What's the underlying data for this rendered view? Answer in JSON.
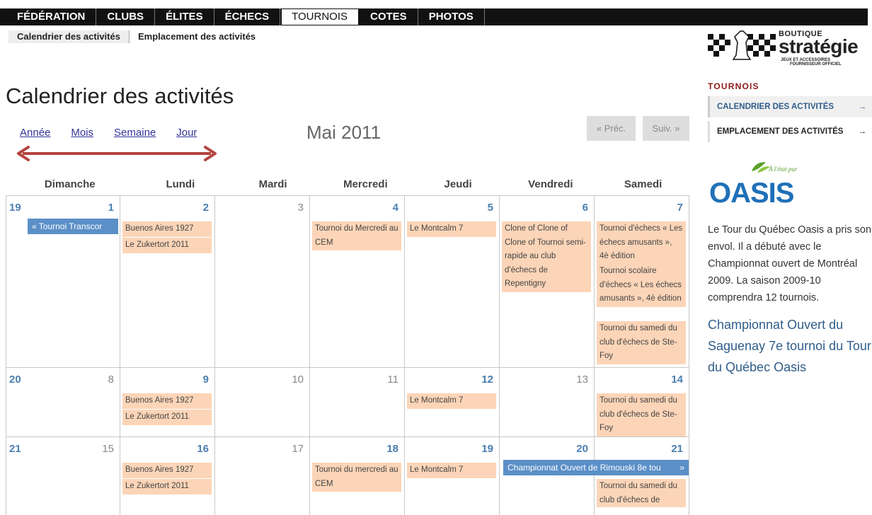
{
  "topnav": {
    "items": [
      {
        "label": "FÉDÉRATION"
      },
      {
        "label": "CLUBS"
      },
      {
        "label": "ÉLITES"
      },
      {
        "label": "ÉCHECS"
      },
      {
        "label": "TOURNOIS"
      },
      {
        "label": "COTES"
      },
      {
        "label": "PHOTOS"
      }
    ],
    "active": "TOURNOIS"
  },
  "subnav": {
    "items": [
      {
        "label": "Calendrier des activités"
      },
      {
        "label": "Emplacement des activités"
      }
    ]
  },
  "logo": {
    "boutique": "BOUTIQUE",
    "name": "stratégie",
    "tagline1": "JEUX ET ACCESSOIRES",
    "tagline2": "FOURNISSEUR OFFICIEL",
    "icon": "chess-board-logo"
  },
  "page": {
    "title": "Calendrier des activités",
    "views": [
      "Année",
      "Mois",
      "Semaine",
      "Jour"
    ],
    "month": "Mai 2011",
    "prev": "« Préc.",
    "next": "Suiv. »",
    "accent": "#4a7eb0",
    "event_color": "#fcd5b8",
    "multi_event_color": "#5b8fc7",
    "arrow_color": "#b5433e"
  },
  "calendar": {
    "day_headers": [
      "Dimanche",
      "Lundi",
      "Mardi",
      "Mercredi",
      "Jeudi",
      "Vendredi",
      "Samedi"
    ],
    "weeks": [
      {
        "week": "19",
        "days": [
          "1",
          "2",
          "3",
          "4",
          "5",
          "6",
          "7"
        ],
        "multi": "« Tournoi Transcor",
        "events": {
          "mon": [
            "Buenos Aires 1927",
            "Le Zukertort 2011"
          ],
          "wed": [
            "Tournoi du Mercredi au CEM"
          ],
          "thu": [
            "Le Montcalm 7"
          ],
          "fri": [
            "Clone of Clone of Clone of Tournoi semi-rapide au club d'échecs de Repentigny"
          ],
          "sat": [
            "Tournoi d'échecs « Les échecs amusants », 4è édition",
            "Tournoi scolaire d'échecs « Les échecs amusants », 4è édition",
            "Tournoi du samedi du club d'échecs de Ste-Foy"
          ]
        }
      },
      {
        "week": "20",
        "days": [
          "8",
          "9",
          "10",
          "11",
          "12",
          "13",
          "14"
        ],
        "events": {
          "mon": [
            "Buenos Aires 1927",
            "Le Zukertort 2011"
          ],
          "thu": [
            "Le Montcalm 7"
          ],
          "sat": [
            "Tournoi du samedi du club d'échecs de Ste-Foy"
          ]
        }
      },
      {
        "week": "21",
        "days": [
          "15",
          "16",
          "17",
          "18",
          "19",
          "20",
          "21"
        ],
        "multi": "Championnat Ouvert de Rimouski 8e tou",
        "multi_arrow": "»",
        "events": {
          "mon": [
            "Buenos Aires 1927",
            "Le Zukertort 2011"
          ],
          "wed": [
            "Tournoi du mercredi au CEM"
          ],
          "thu": [
            "Le Montcalm 7"
          ],
          "sat": [
            "Tournoi du samedi du club d'échecs de"
          ]
        }
      }
    ]
  },
  "sidebar": {
    "heading": "TOURNOIS",
    "items": [
      {
        "label": "CALENDRIER DES ACTIVITÉS",
        "arrow": "→"
      },
      {
        "label": "EMPLACEMENT DES ACTIVITÉS",
        "arrow": "→"
      }
    ],
    "oasis_tagline": "À l'état pur",
    "oasis_brand": "OASIS",
    "oasis_text": "Le Tour du Québec Oasis a pris son envol. Il a débuté avec le Championnat ouvert de Montréal 2009. La saison 2009-10 comprendra 12 tournois.",
    "oasis_link": "Championnat Ouvert du Saguenay 7e tournoi du Tour du Québec Oasis"
  }
}
